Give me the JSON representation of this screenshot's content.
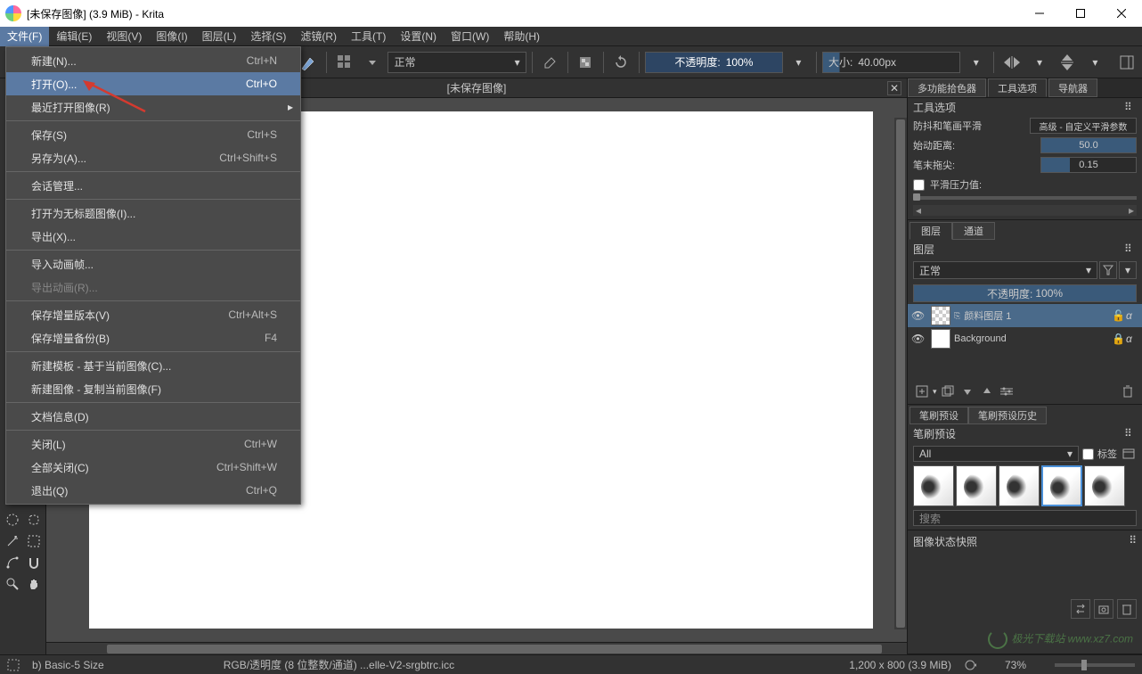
{
  "titlebar": {
    "title": "[未保存图像] (3.9 MiB) - Krita"
  },
  "menubar": {
    "items": [
      "文件(F)",
      "编辑(E)",
      "视图(V)",
      "图像(I)",
      "图层(L)",
      "选择(S)",
      "滤镜(R)",
      "工具(T)",
      "设置(N)",
      "窗口(W)",
      "帮助(H)"
    ]
  },
  "toolbar": {
    "blend_mode": "正常",
    "opacity_label": "不透明度:",
    "opacity_value": "100%",
    "size_label": "大小:",
    "size_value": "40.00px"
  },
  "file_menu": {
    "items": [
      {
        "label": "新建(N)...",
        "shortcut": "Ctrl+N"
      },
      {
        "label": "打开(O)...",
        "shortcut": "Ctrl+O",
        "hl": true
      },
      {
        "label": "最近打开图像(R)",
        "submenu": true
      },
      {
        "sep": true
      },
      {
        "label": "保存(S)",
        "shortcut": "Ctrl+S"
      },
      {
        "label": "另存为(A)...",
        "shortcut": "Ctrl+Shift+S"
      },
      {
        "sep": true
      },
      {
        "label": "会话管理..."
      },
      {
        "sep": true
      },
      {
        "label": "打开为无标题图像(I)..."
      },
      {
        "label": "导出(X)..."
      },
      {
        "sep": true
      },
      {
        "label": "导入动画帧..."
      },
      {
        "label": "导出动画(R)...",
        "disabled": true
      },
      {
        "sep": true
      },
      {
        "label": "保存增量版本(V)",
        "shortcut": "Ctrl+Alt+S"
      },
      {
        "label": "保存增量备份(B)",
        "shortcut": "F4"
      },
      {
        "sep": true
      },
      {
        "label": "新建模板 - 基于当前图像(C)..."
      },
      {
        "label": "新建图像 - 复制当前图像(F)"
      },
      {
        "sep": true
      },
      {
        "label": "文档信息(D)"
      },
      {
        "sep": true
      },
      {
        "label": "关闭(L)",
        "shortcut": "Ctrl+W"
      },
      {
        "label": "全部关闭(C)",
        "shortcut": "Ctrl+Shift+W"
      },
      {
        "label": "退出(Q)",
        "shortcut": "Ctrl+Q"
      }
    ]
  },
  "canvas": {
    "tab_title": "[未保存图像]"
  },
  "right": {
    "tabs": [
      "多功能拾色器",
      "工具选项",
      "导航器"
    ],
    "tool_options_title": "工具选项",
    "smoothing_label": "防抖和笔画平滑",
    "smoothing_value": "高级 - 自定义平滑参数",
    "start_dist_label": "始动距离:",
    "start_dist_value": "50.0",
    "tip_label": "笔末拖尖:",
    "tip_value": "0.15",
    "pressure_label": "平滑压力值:",
    "layer_tabs": [
      "图层",
      "通道"
    ],
    "layers_title": "图层",
    "layer_blend": "正常",
    "layer_opacity_label": "不透明度:",
    "layer_opacity_value": "100%",
    "layers": [
      {
        "name": "颜料图层 1",
        "selected": true
      },
      {
        "name": "Background"
      }
    ],
    "brush_tabs": [
      "笔刷预设",
      "笔刷预设历史"
    ],
    "brush_title": "笔刷预设",
    "brush_filter": "All",
    "brush_tag_label": "标签",
    "search_placeholder": "搜索",
    "snapshot_title": "图像状态快照"
  },
  "statusbar": {
    "brush": "b) Basic-5 Size",
    "color": "RGB/透明度 (8 位整数/通道) ...elle-V2-srgbtrc.icc",
    "dims": "1,200 x 800 (3.9 MiB)",
    "zoom": "73%"
  },
  "watermark": "极光下载站 www.xz7.com"
}
